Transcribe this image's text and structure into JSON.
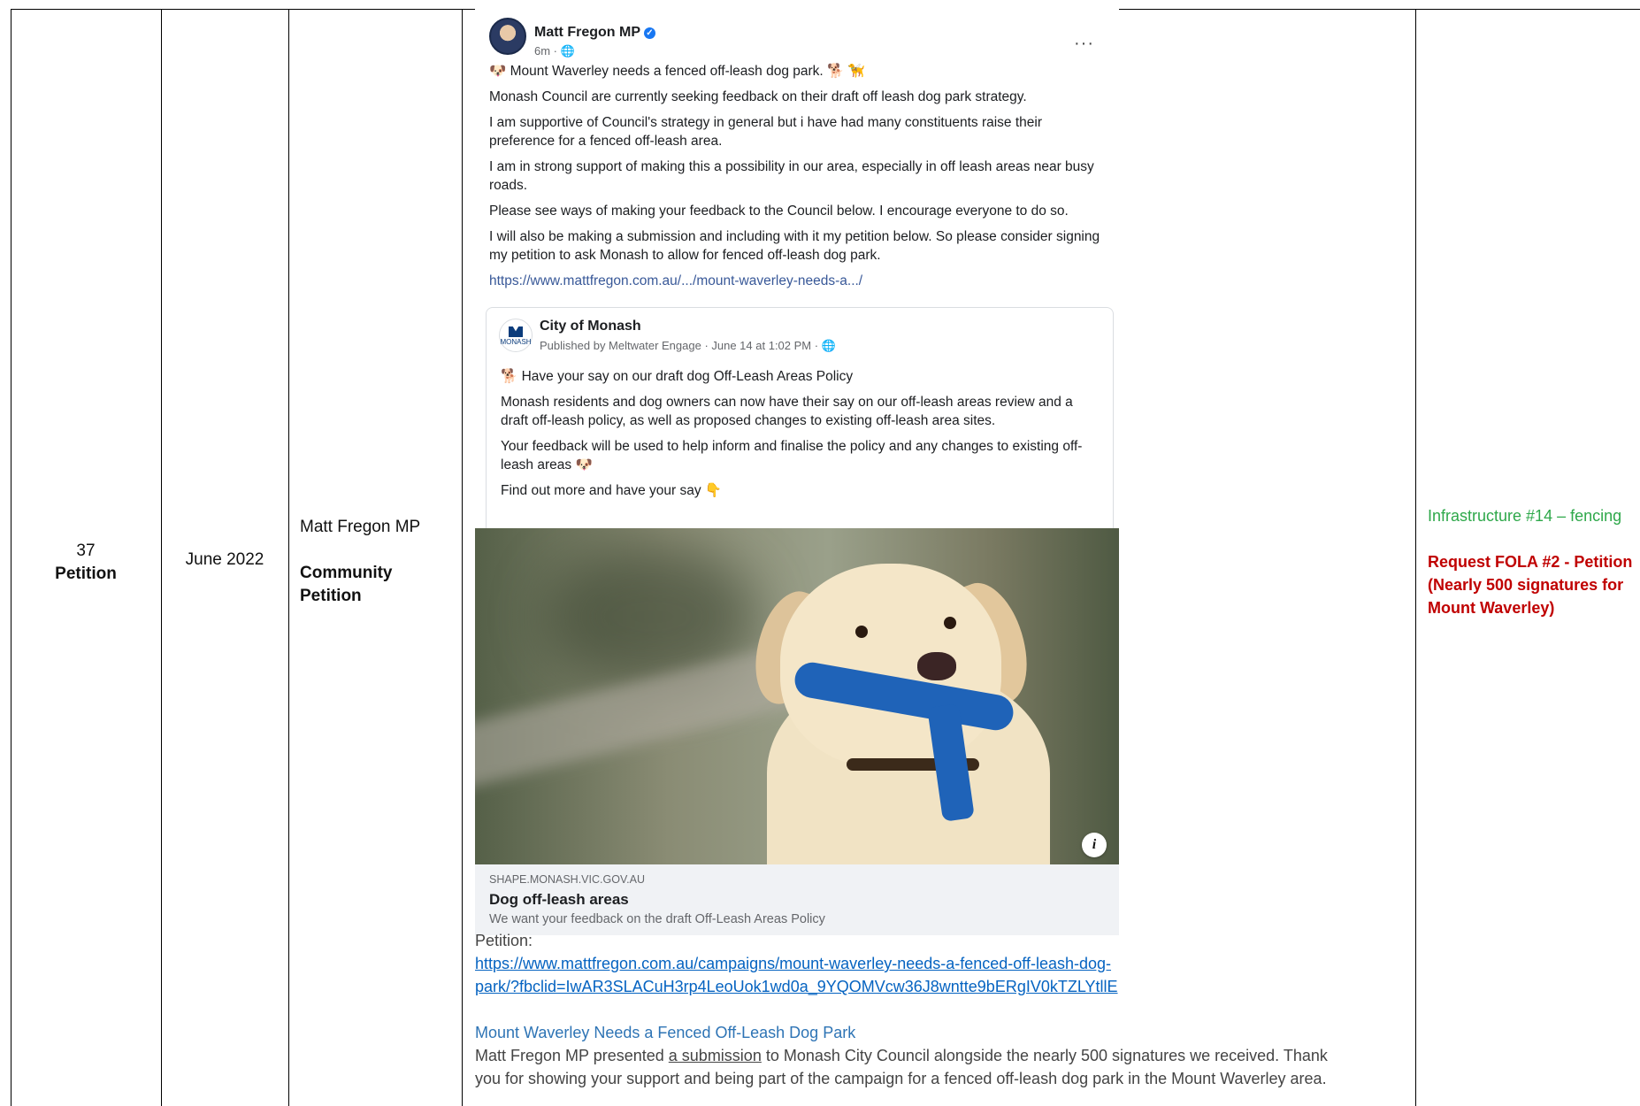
{
  "row": {
    "number": "37",
    "type": "Petition",
    "date": "June 2022",
    "source_name": "Matt Fregon MP",
    "source_type_line1": "Community",
    "source_type_line2": "Petition"
  },
  "post": {
    "author": "Matt Fregon MP",
    "meta": "6m ·",
    "more_label": "···",
    "paragraphs": [
      "🐶 Mount Waverley needs a fenced off-leash dog park. 🐕 🦮",
      "Monash Council are currently seeking feedback on their draft off leash dog park strategy.",
      "I am supportive of Council's strategy in general but i have had many constituents raise their preference for a fenced off-leash area.",
      "I am in strong support of making this a possibility in our area, especially in off leash areas near busy roads.",
      "Please see ways of making your feedback to the Council below. I encourage everyone to do so.",
      "I will also be making a submission and including with it my petition below. So please consider signing my petition to ask Monash to allow for fenced off-leash dog park."
    ],
    "link": "https://www.mattfregon.com.au/.../mount-waverley-needs-a.../"
  },
  "shared": {
    "page_name": "City of Monash",
    "page_logo_text": "MONASH",
    "meta": "Published by Meltwater Engage · June 14 at 1:02 PM ·",
    "paragraphs": [
      "🐕 Have your say on our draft dog Off-Leash Areas Policy",
      "Monash residents and dog owners can now have their say on our off-leash areas review and a draft off-leash policy, as well as proposed changes to existing off-leash area sites.",
      "Your feedback will be used to help inform and finalise the policy and any changes to existing off-leash areas 🐶",
      "Find out more and have your say 👇"
    ]
  },
  "link_card": {
    "domain": "SHAPE.MONASH.VIC.GOV.AU",
    "title": "Dog off-leash areas",
    "description": "We want your feedback on the draft Off-Leash Areas Policy",
    "info_label": "i"
  },
  "petition": {
    "label": "Petition:",
    "url_line1": "https://www.mattfregon.com.au/campaigns/mount-waverley-needs-a-fenced-off-leash-dog-",
    "url_line2": "park/?fbclid=IwAR3SLACuH3rp4LeoUok1wd0a_9YQOMVcw36J8wntte9bERgIV0kTZLYtllE",
    "heading": "Mount Waverley Needs a Fenced Off-Leash Dog Park",
    "text_before": "Matt Fregon MP presented ",
    "text_link": "a submission",
    "text_after": " to Monash City Council alongside the nearly 500 signatures we received. Thank you for showing your support and being part of the campaign for a fenced off-leash dog park in the Mount Waverley area."
  },
  "notes": {
    "category": "Infrastructure #14 – fencing",
    "request_line1": "Request FOLA #2 - Petition",
    "request_line2": "(Nearly 500 signatures for",
    "request_line3": "Mount Waverley)"
  },
  "colors": {
    "category_green": "#2ea84a",
    "request_red": "#c00000",
    "link_blue": "#385898"
  }
}
